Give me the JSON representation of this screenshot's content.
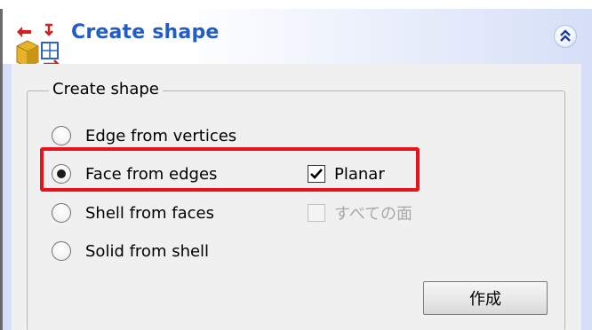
{
  "panel": {
    "title": "Create shape",
    "icon": "create-shape-icon",
    "collapse_icon": "chevron-double-up-icon"
  },
  "group": {
    "label": "Create shape"
  },
  "options": [
    {
      "label": "Edge from vertices",
      "selected": false
    },
    {
      "label": "Face from edges",
      "selected": true
    },
    {
      "label": "Shell from faces",
      "selected": false
    },
    {
      "label": "Solid from shell",
      "selected": false
    }
  ],
  "checkboxes": [
    {
      "label": "Planar",
      "checked": true,
      "enabled": true
    },
    {
      "label": "すべての面",
      "checked": false,
      "enabled": false
    }
  ],
  "button": {
    "label": "作成"
  },
  "colors": {
    "title": "#215dc6",
    "highlight": "#e8121b",
    "panel_background": "#d6dff7",
    "body_background": "#f0f0f0"
  }
}
